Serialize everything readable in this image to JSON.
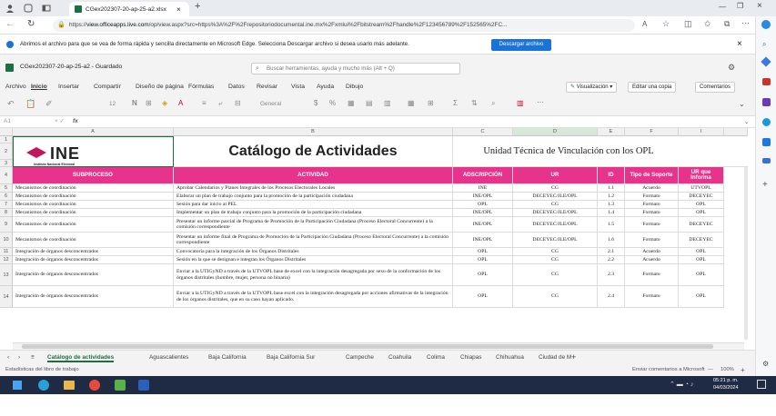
{
  "browser": {
    "tab_title": "CGex202307-20-ap-25-a2.xlsx",
    "url_prefix": "https://",
    "url_host": "view.officeapps.live.com",
    "url_rest": "/op/view.aspx?src=https%3A%2F%2Frepositoriodocumental.ine.mx%2Fxmlui%2Fbitstream%2Fhandle%2F123456789%2F152565%2FC...",
    "infobar_text": "Abrimos el archivo para que se vea de forma rápida y sencilla directamente en Microsoft Edge. Selecciona Descargar archivo si desea usarlo más adelante.",
    "download_label": "Descargar archivo"
  },
  "app": {
    "doc_title": "CGex202307-20-ap-25-a2  -  Guardado",
    "search_placeholder": "Buscar herramientas, ayuda y mucho más (Alt + Q)",
    "ribbon_tabs": [
      "Archivo",
      "Inicio",
      "Insertar",
      "Compartir",
      "Diseño de página",
      "Fórmulas",
      "Datos",
      "Revisar",
      "Vista",
      "Ayuda",
      "Dibujo"
    ],
    "visualizacion_label": "Visualización",
    "edit_copy_label": "Editar una copia",
    "comments_label": "Comentarios",
    "font_size": "12",
    "number_format": "General",
    "name_box": "A1",
    "fx": "fx"
  },
  "sheet": {
    "col_letters": [
      "A",
      "B",
      "C",
      "D",
      "E",
      "F",
      "I"
    ],
    "logo_text": "INE",
    "logo_sub": "Instituto Nacional Electoral",
    "title": "Catálogo de Actividades",
    "unit": "Unidad Técnica de Vinculación con los OPL",
    "headers": [
      "SUBPROCESO",
      "ACTIVIDAD",
      "ADSCRIPCIÓN",
      "UR",
      "ID",
      "Tipo de Soporte",
      "UR que Informa"
    ],
    "rows": [
      {
        "n": "5",
        "sub": "Mecanismos de coordinación",
        "act": "Aprobar Calendarios y Planes Integrales de los Procesos Electorales Locales",
        "ads": "INE",
        "ur": "CG",
        "id": "1.1",
        "tipo": "Acuerdo",
        "uri": "UTVOPL"
      },
      {
        "n": "6",
        "sub": "Mecanismos de coordinación",
        "act": "Elaborar un plan de trabajo conjunto para la promoción de la participación ciudadana",
        "ads": "INE/OPL",
        "ur": "DECEYEC/JLE/OPL",
        "id": "1.2",
        "tipo": "Formato",
        "uri": "DECEYEC"
      },
      {
        "n": "7",
        "sub": "Mecanismos de coordinación",
        "act": "Sesión para dar inicio al PEL",
        "ads": "OPL",
        "ur": "CG",
        "id": "1.3",
        "tipo": "Formato",
        "uri": "OPL"
      },
      {
        "n": "8",
        "sub": "Mecanismos de coordinación",
        "act": "Implementar un plan de trabajo conjunto para la promoción de la participación ciudadana",
        "ads": "INE/OPL",
        "ur": "DECEYEC/JLE/OPL",
        "id": "1.4",
        "tipo": "Formato",
        "uri": "OPL"
      },
      {
        "n": "9",
        "sub": "Mecanismos de coordinación",
        "act": "Presentar un informe parcial de Programa de Promoción de la Participación Ciudadana (Proceso Electoral Concurrente) a la comisión correspondiente",
        "ads": "INE/OPL",
        "ur": "DECEYEC/JLE/OPL",
        "id": "1.5",
        "tipo": "Formato",
        "uri": "DECEYEC"
      },
      {
        "n": "10",
        "sub": "Mecanismos de coordinación",
        "act": "Presentar un informe final de Programa de Promoción de la Participación Ciudadana (Proceso Electoral Concurrente) a la comisión correspondiente",
        "ads": "INE/OPL",
        "ur": "DECEYEC/JLE/OPL",
        "id": "1.6",
        "tipo": "Formato",
        "uri": "DECEYEC"
      },
      {
        "n": "11",
        "sub": "Integración de órganos desconcentrados",
        "act": "Convocatoria para la integración de los Órganos Distritales",
        "ads": "OPL",
        "ur": "CG",
        "id": "2.1",
        "tipo": "Acuerdo",
        "uri": "OPL"
      },
      {
        "n": "12",
        "sub": "Integración de órganos desconcentrados",
        "act": "Sesión en la que se designan e integran los Órganos Distritales",
        "ads": "OPL",
        "ur": "CG",
        "id": "2.2",
        "tipo": "Acuerdo",
        "uri": "OPL"
      },
      {
        "n": "13",
        "sub": "Integración de órganos desconcentrados",
        "act": "Enviar a la UTIGyND a través de la UTVOPL base de excel con la integración desagregada por sexo de la conformación de los órganos distritales (hombre, mujer, persona no binaria)",
        "ads": "OPL",
        "ur": "CG",
        "id": "2.3",
        "tipo": "Formato",
        "uri": "OPL"
      },
      {
        "n": "14",
        "sub": "Integración de órganos desconcentrados",
        "act": "Enviar a la UTIGyND a través de la UTVOPL base excel con la integración desagregada por acciones afirmativas de la integración de los órganos distritales, que en su caso hayan aplicado.",
        "ads": "OPL",
        "ur": "CG",
        "id": "2.4",
        "tipo": "Formato",
        "uri": "OPL"
      }
    ]
  },
  "sheet_tabs": [
    "Catálogo de actividades",
    "Aguascalientes",
    "Baja California",
    "Baja California Sur",
    "Campeche",
    "Coahuila",
    "Colima",
    "Chiapas",
    "Chihuahua",
    "Ciudad de M"
  ],
  "status": {
    "left": "Estadísticas del libro de trabajo",
    "feedback": "Enviar comentarios a Microsoft",
    "zoom": "100%"
  },
  "taskbar": {
    "time": "05:21 p. m.",
    "date": "04/03/2024"
  },
  "colors": {
    "accent_pink": "#e8338d",
    "excel_green": "#1d6f42",
    "edge_blue": "#1a73d8",
    "taskbar": "#1f2a44"
  }
}
